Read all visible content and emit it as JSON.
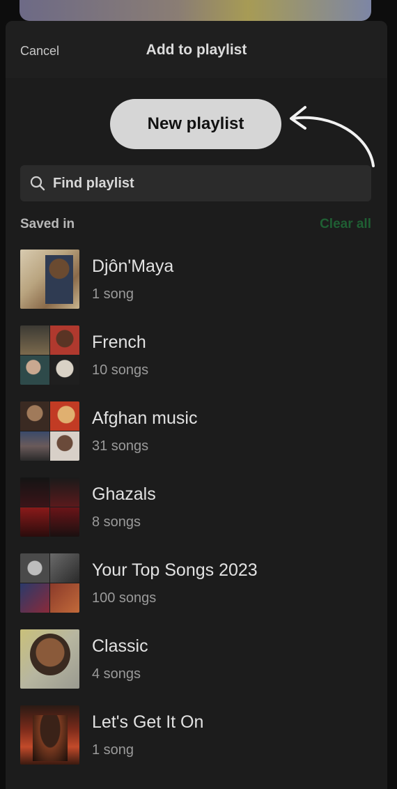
{
  "header": {
    "cancel_label": "Cancel",
    "title": "Add to playlist"
  },
  "new_playlist_label": "New playlist",
  "search": {
    "placeholder": "Find playlist"
  },
  "section": {
    "label": "Saved in",
    "clear_label": "Clear all"
  },
  "colors": {
    "accent_green": "#1f5f33",
    "sheet_bg": "#1c1c1c",
    "button_bg": "#d6d6d6"
  },
  "playlists": [
    {
      "name": "Djôn'Maya",
      "count": "1 song",
      "art": "single-portrait-cover"
    },
    {
      "name": "French",
      "count": "10 songs",
      "art": "four-cover-mosaic"
    },
    {
      "name": "Afghan music",
      "count": "31 songs",
      "art": "four-cover-mosaic"
    },
    {
      "name": "Ghazals",
      "count": "8 songs",
      "art": "four-cover-mosaic"
    },
    {
      "name": "Your Top Songs 2023",
      "count": "100 songs",
      "art": "four-cover-mosaic"
    },
    {
      "name": "Classic",
      "count": "4 songs",
      "art": "single-portrait-cover"
    },
    {
      "name": "Let's Get It On",
      "count": "1 song",
      "art": "single-portrait-cover"
    }
  ]
}
